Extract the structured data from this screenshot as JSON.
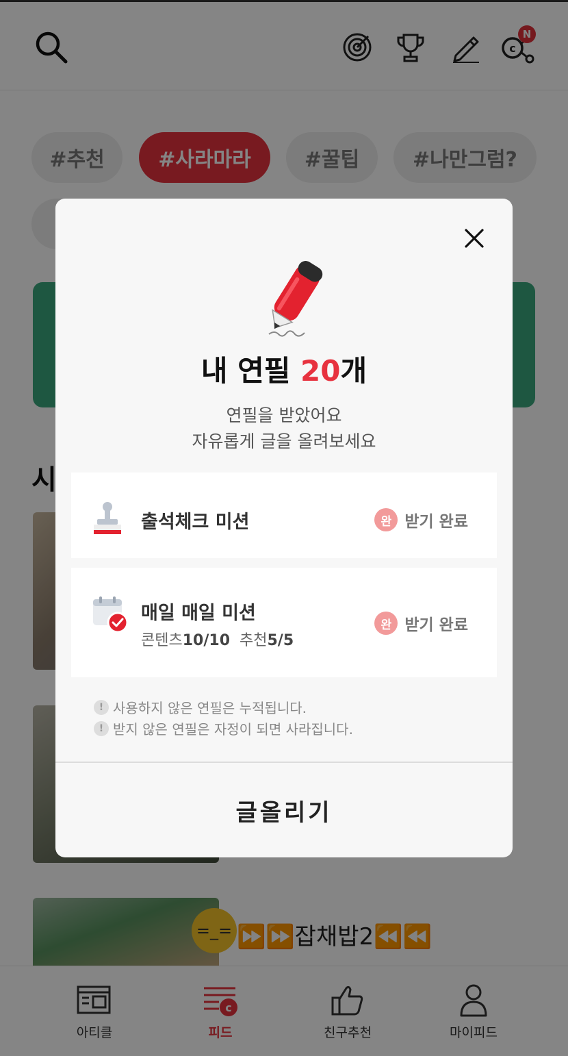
{
  "header": {
    "notification_badge": "N",
    "icons": [
      "search-icon",
      "target-icon",
      "trophy-icon",
      "pencil-icon",
      "coin-share-icon"
    ]
  },
  "tags": [
    "#추천",
    "#사라마라",
    "#꿀팁",
    "#나만그럼?"
  ],
  "active_tag_index": 1,
  "section_title_partial": "시",
  "post": {
    "title": "⏩⏩잡채밥2⏪⏪"
  },
  "bottom_nav": [
    {
      "label": "아티클",
      "icon": "article-icon"
    },
    {
      "label": "피드",
      "icon": "feed-icon",
      "active": true
    },
    {
      "label": "친구추천",
      "icon": "thumbs-up-icon"
    },
    {
      "label": "마이피드",
      "icon": "person-icon"
    }
  ],
  "modal": {
    "title_prefix": "내 연필 ",
    "title_count": "20",
    "title_suffix": "개",
    "subtitle_line1": "연필을 받았어요",
    "subtitle_line2": "자유롭게 글을 올려보세요",
    "missions": [
      {
        "title": "출석체크 미션",
        "badge": "완",
        "status": "받기 완료",
        "icon": "stamp-icon"
      },
      {
        "title": "매일 매일 미션",
        "detail_label1": "콘텐츠",
        "detail_value1": "10/10",
        "detail_label2": "추천",
        "detail_value2": "5/5",
        "badge": "완",
        "status": "받기 완료",
        "icon": "calendar-check-icon"
      }
    ],
    "notes": [
      "사용하지 않은 연필은 누적됩니다.",
      "받지 않은 연필은 자정이 되면 사라집니다."
    ],
    "note_mark": "!",
    "cta_label": "글올리기"
  },
  "colors": {
    "accent": "#e7323f",
    "banner": "#3aa77e",
    "done_badge": "#f29a9a"
  }
}
